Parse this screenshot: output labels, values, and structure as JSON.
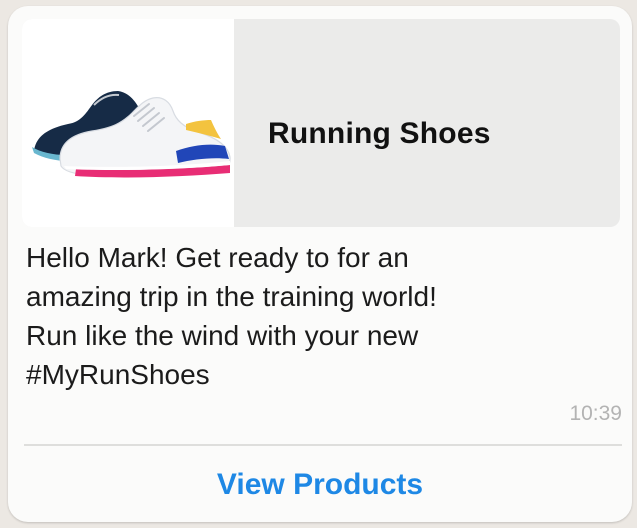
{
  "card": {
    "title": "Running Shoes",
    "image_icon": "running-shoes-image"
  },
  "message": {
    "lines": [
      "Hello Mark! Get ready to for an",
      "amazing trip in the training world!",
      "Run like the wind with your new",
      "#MyRunShoes"
    ],
    "time": "10:39"
  },
  "actions": {
    "view_products": "View Products"
  },
  "colors": {
    "background": "#ece8e3",
    "bubble": "#fbfbfa",
    "card": "#ebebea",
    "link": "#1e88e5",
    "shoe_white": "#f4f5f7",
    "shoe_navy": "#162b46",
    "shoe_pink": "#e82d75",
    "shoe_blue": "#2146b8",
    "shoe_yellow": "#f3c33f"
  }
}
